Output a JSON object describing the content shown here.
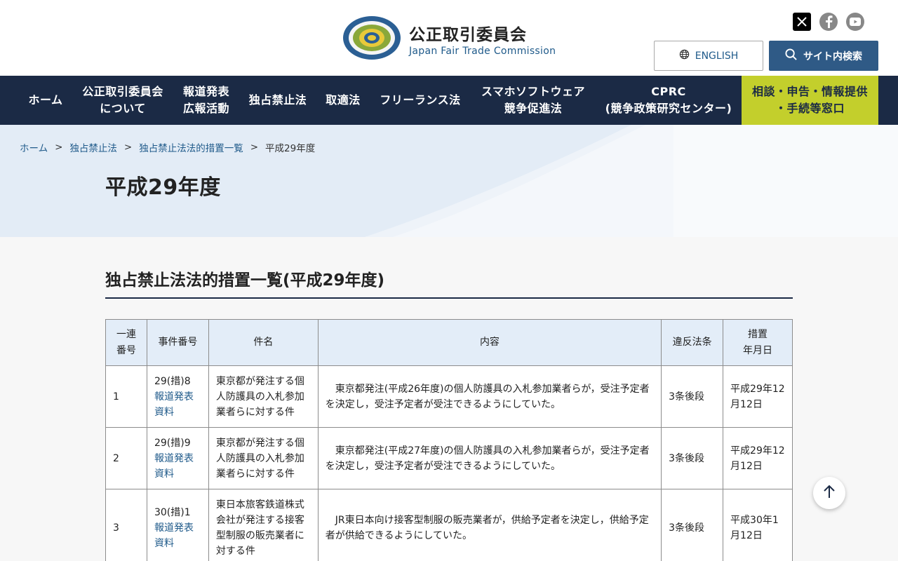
{
  "header": {
    "logo_ja": "公正取引委員会",
    "logo_en": "Japan Fair Trade Commission",
    "logo_seal_text": "JAPAN FAIR TRADE COMMISSION",
    "english_label": "ENGLISH",
    "search_label": "サイト内検索",
    "sns": [
      "x-icon",
      "facebook-icon",
      "youtube-icon"
    ]
  },
  "nav": {
    "items": [
      {
        "label": "ホーム"
      },
      {
        "label": "公正取引委員会\nについて"
      },
      {
        "label": "報道発表\n広報活動"
      },
      {
        "label": "独占禁止法"
      },
      {
        "label": "取適法"
      },
      {
        "label": "フリーランス法"
      },
      {
        "label": "スマホソフトウェア\n競争促進法"
      },
      {
        "label": "CPRC\n(競争政策研究センター)"
      },
      {
        "label": "相談・申告・情報提供\n・手続等窓口"
      }
    ]
  },
  "breadcrumb": {
    "items": [
      "ホーム",
      "独占禁止法",
      "独占禁止法法的措置一覧"
    ],
    "separator": ">",
    "current": "平成29年度"
  },
  "page_title": "平成29年度",
  "section_title": "独占禁止法法的措置一覧(平成29年度)",
  "table": {
    "headers": [
      "一連\n番号",
      "事件番号",
      "件名",
      "内容",
      "違反法条",
      "措置\n年月日"
    ],
    "rows": [
      {
        "no": "1",
        "case_no": "29(措)8",
        "link": "報道発表資料",
        "subject": "東京都が発注する個人防護具の入札参加業者らに対する件",
        "content": "東京都発注(平成26年度)の個人防護具の入札参加業者らが，受注予定者を決定し，受注予定者が受注できるようにしていた。",
        "law": "3条後段",
        "date": "平成29年12月12日"
      },
      {
        "no": "2",
        "case_no": "29(措)9",
        "link": "報道発表資料",
        "subject": "東京都が発注する個人防護具の入札参加業者らに対する件",
        "content": "東京都発注(平成27年度)の個人防護具の入札参加業者らが，受注予定者を決定し，受注予定者が受注できるようにしていた。",
        "law": "3条後段",
        "date": "平成29年12月12日"
      },
      {
        "no": "3",
        "case_no": "30(措)1",
        "link": "報道発表資料",
        "subject": "東日本旅客鉄道株式会社が発注する接客型制服の販売業者に対する件",
        "content": "JR東日本向け接客型制服の販売業者が，供給予定者を決定し，供給予定者が供給できるようにしていた。",
        "law": "3条後段",
        "date": "平成30年1月12日"
      }
    ]
  },
  "colors": {
    "nav_bg": "#1b2a45",
    "consult_bg": "#c3cf2c",
    "link": "#1f5a8a",
    "search_btn": "#2f5a86",
    "table_header": "#e3edf8"
  }
}
